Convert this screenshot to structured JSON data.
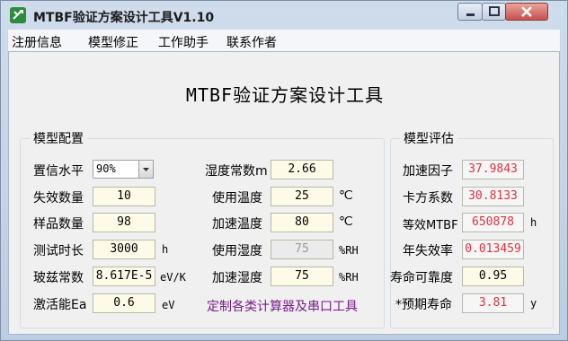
{
  "window": {
    "title": "MTBF验证方案设计工具V1.10"
  },
  "menu": {
    "items": [
      "注册信息",
      "模型修正",
      "工作助手",
      "联系作者"
    ]
  },
  "app_title": "MTBF验证方案设计工具",
  "config": {
    "legend": "模型配置",
    "confidence": {
      "label": "置信水平",
      "value": "90%"
    },
    "failures": {
      "label": "失效数量",
      "value": "10"
    },
    "samples": {
      "label": "样品数量",
      "value": "98"
    },
    "test_time": {
      "label": "测试时长",
      "value": "3000",
      "unit": "h"
    },
    "boltzmann": {
      "label": "玻兹常数",
      "value": "8.617E-5",
      "unit": "eV/K"
    },
    "activation": {
      "label": "激活能Ea",
      "value": "0.6",
      "unit": "eV"
    },
    "humidity_const": {
      "label": "湿度常数m",
      "value": "2.66"
    },
    "use_temp": {
      "label": "使用温度",
      "value": "25",
      "unit": "℃"
    },
    "acc_temp": {
      "label": "加速温度",
      "value": "80",
      "unit": "℃"
    },
    "use_humidity": {
      "label": "使用湿度",
      "value": "75",
      "unit": "%RH"
    },
    "acc_humidity": {
      "label": "加速湿度",
      "value": "75",
      "unit": "%RH"
    },
    "custom_link": "定制各类计算器及串口工具"
  },
  "eval": {
    "legend": "模型评估",
    "acc_factor": {
      "label": "加速因子",
      "value": "37.9843"
    },
    "chi_square": {
      "label": "卡方系数",
      "value": "30.8133"
    },
    "eq_mtbf": {
      "label": "等效MTBF",
      "value": "650878",
      "unit": "h"
    },
    "annual_failure": {
      "label": "年失效率",
      "value": "0.013459"
    },
    "life_reliability": {
      "label": "寿命可靠度",
      "value": "0.95"
    },
    "expected_life": {
      "label": "*预期寿命",
      "value": "3.81",
      "unit": "y"
    }
  },
  "colors": {
    "accent_red": "#e0323b",
    "link_purple": "#7a1a8a"
  }
}
